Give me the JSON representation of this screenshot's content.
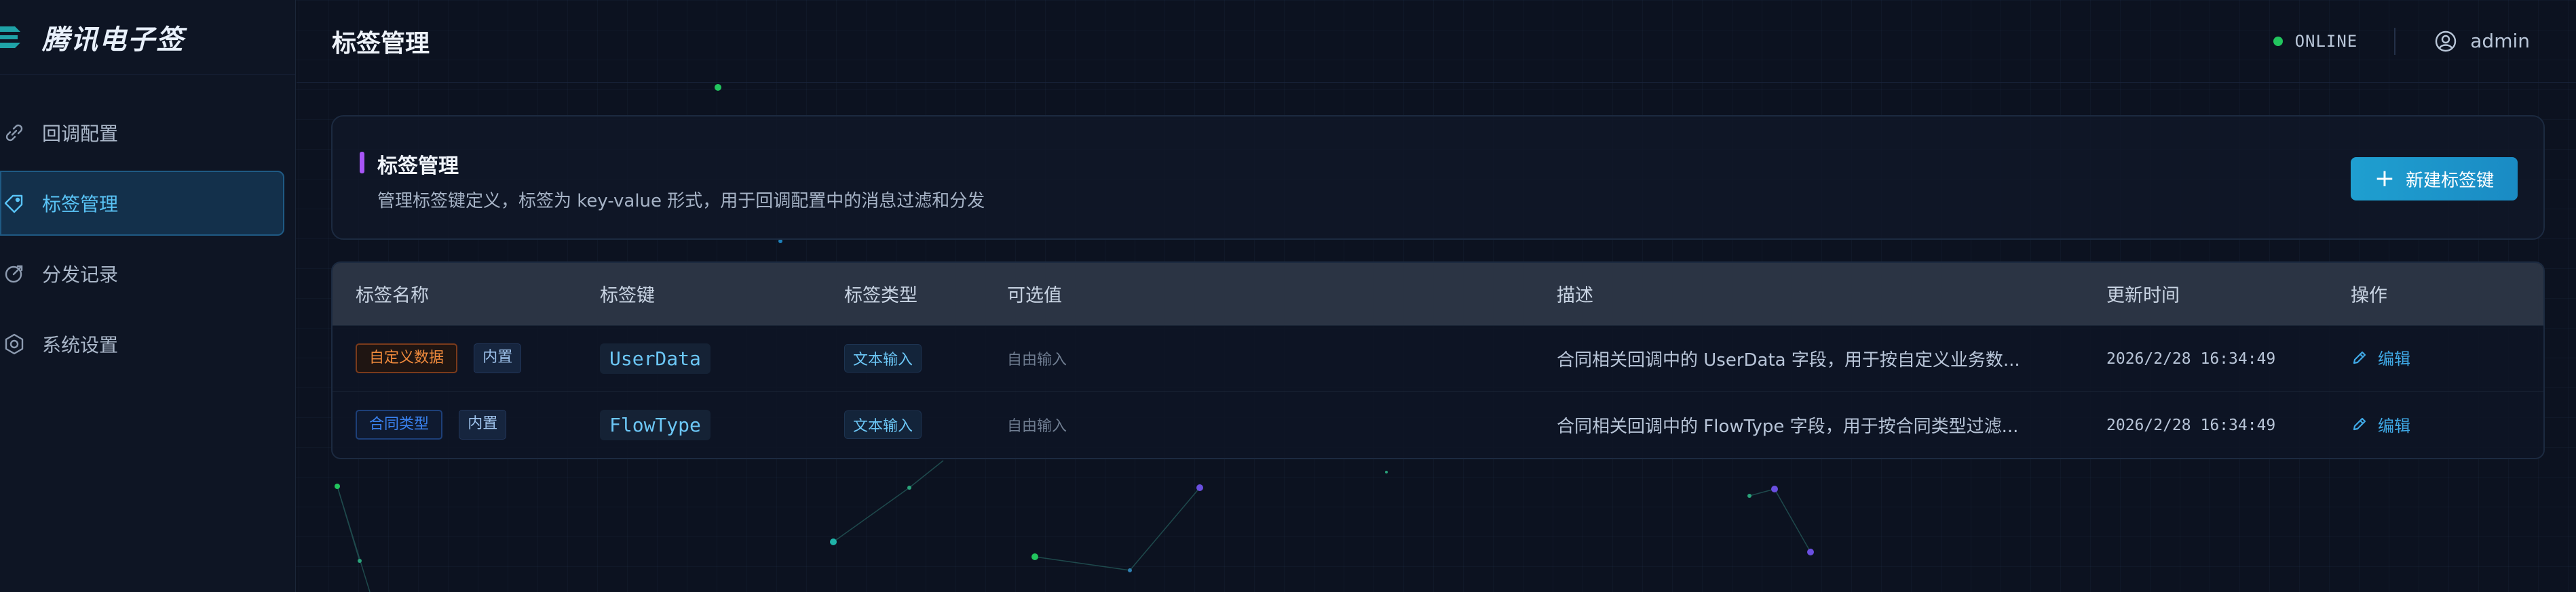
{
  "app": {
    "name": "腾讯电子签",
    "accent": "#1fa3a8"
  },
  "sidebar": {
    "items": [
      {
        "label": "回调配置",
        "icon": "link-icon",
        "active": false
      },
      {
        "label": "标签管理",
        "icon": "tag-icon",
        "active": true
      },
      {
        "label": "分发记录",
        "icon": "dispatch-icon",
        "active": false
      },
      {
        "label": "系统设置",
        "icon": "settings-icon",
        "active": false
      }
    ]
  },
  "header": {
    "title": "标签管理",
    "status": "ONLINE",
    "status_color": "#22c55e",
    "user": "admin"
  },
  "intro": {
    "title": "标签管理",
    "description": "管理标签键定义，标签为 key-value 形式，用于回调配置中的消息过滤和分发",
    "new_button": "新建标签键",
    "accent": "#a855f7"
  },
  "table": {
    "columns": [
      "标签名称",
      "标签键",
      "标签类型",
      "可选值",
      "描述",
      "更新时间",
      "操作"
    ],
    "rows": [
      {
        "name": "自定义数据",
        "name_color": "orange",
        "builtin": "内置",
        "key": "UserData",
        "type": "文本输入",
        "options": "自由输入",
        "description": "合同相关回调中的 UserData 字段，用于按自定义业务数...",
        "updated": "2026/2/28 16:34:49",
        "action": "编辑"
      },
      {
        "name": "合同类型",
        "name_color": "blue",
        "builtin": "内置",
        "key": "FlowType",
        "type": "文本输入",
        "options": "自由输入",
        "description": "合同相关回调中的 FlowType 字段，用于按合同类型过滤...",
        "updated": "2026/2/28 16:34:49",
        "action": "编辑"
      }
    ]
  }
}
